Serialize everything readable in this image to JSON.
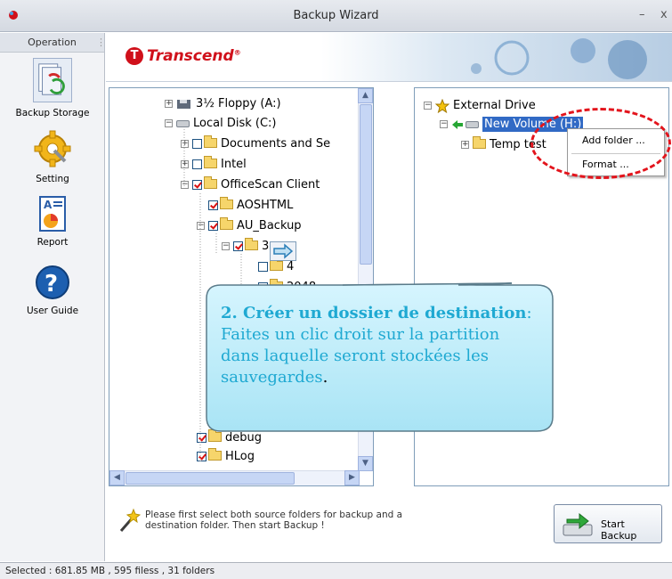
{
  "window": {
    "title": "Backup Wizard",
    "minimize": "–",
    "close": "x"
  },
  "sidebar": {
    "header": "Operation",
    "items": [
      {
        "label": "Backup Storage",
        "icon": "backup-storage-icon"
      },
      {
        "label": "Setting",
        "icon": "gear-icon"
      },
      {
        "label": "Report",
        "icon": "report-icon"
      },
      {
        "label": "User Guide",
        "icon": "help-icon"
      }
    ]
  },
  "brand": {
    "logo_text": "Transcend",
    "logo_mark": "T",
    "color": "#d0101a"
  },
  "source_tree": {
    "rows": [
      {
        "text": "3½ Floppy (A:)",
        "checkbox": null,
        "kind": "floppy"
      },
      {
        "text": "Local Disk (C:)",
        "checkbox": null,
        "kind": "drive"
      },
      {
        "text": "Documents and Se",
        "checkbox": false,
        "kind": "folder"
      },
      {
        "text": "Intel",
        "checkbox": false,
        "kind": "folder"
      },
      {
        "text": "OfficeScan Client",
        "checkbox": true,
        "kind": "folder"
      },
      {
        "text": "AOSHTML",
        "checkbox": true,
        "kind": "folder"
      },
      {
        "text": "AU_Backup",
        "checkbox": true,
        "kind": "folder"
      },
      {
        "text": "3",
        "checkbox": true,
        "kind": "folder"
      },
      {
        "text": "4",
        "checkbox": false,
        "kind": "folder"
      },
      {
        "text": "2048",
        "checkbox": true,
        "kind": "folder"
      },
      {
        "text": "debug",
        "checkbox": true,
        "kind": "folder"
      },
      {
        "text": "HLog",
        "checkbox": true,
        "kind": "folder"
      }
    ]
  },
  "dest_tree": {
    "root": "External Drive",
    "volume": "New Volume (H:)",
    "child": "Temp test"
  },
  "context_menu": {
    "items": [
      "Add folder ...",
      "Format ..."
    ]
  },
  "callout": {
    "title": "2. Créer un dossier de destination",
    "body": ": Faites un clic droit sur la partition dans laquelle seront stockées les sauvegardes",
    "end": "."
  },
  "hint_text": "Please first select both source folders for backup and a destination folder. Then start Backup !",
  "start_backup_label": "Start Backup",
  "status": "Selected : 681.85 MB , 595 filess , 31 folders",
  "colors": {
    "accent": "#1fa9d2",
    "callout_fill": "#c2eefb",
    "highlight": "#e3141c"
  }
}
